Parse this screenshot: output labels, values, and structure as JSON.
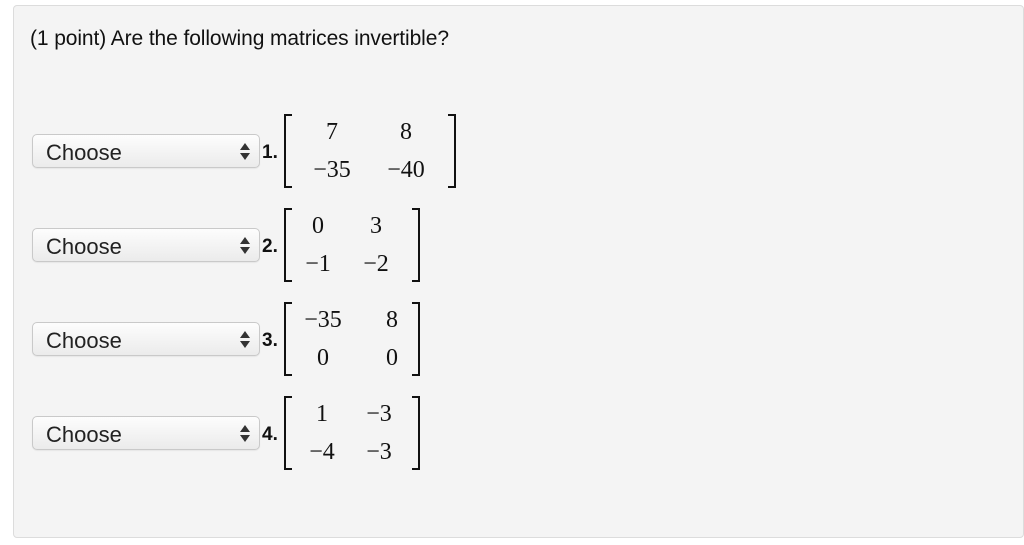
{
  "question": "(1 point) Are the following matrices invertible?",
  "items": [
    {
      "select": "Choose",
      "label": "1.",
      "matrix": [
        [
          "7",
          "8"
        ],
        [
          "−35",
          "−40"
        ]
      ]
    },
    {
      "select": "Choose",
      "label": "2.",
      "matrix": [
        [
          "0",
          "3"
        ],
        [
          "−1",
          "−2"
        ]
      ]
    },
    {
      "select": "Choose",
      "label": "3.",
      "matrix": [
        [
          "−35",
          "8"
        ],
        [
          "0",
          "0"
        ]
      ]
    },
    {
      "select": "Choose",
      "label": "4.",
      "matrix": [
        [
          "1",
          "−3"
        ],
        [
          "−4",
          "−3"
        ]
      ]
    }
  ]
}
